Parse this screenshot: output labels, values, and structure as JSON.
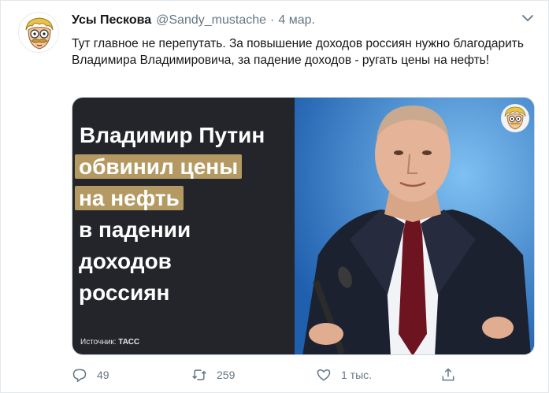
{
  "author": {
    "name": "Усы Пескова",
    "handle": "@Sandy_mustache",
    "separator": "·",
    "date": "4 мар."
  },
  "tweet": {
    "text": "Тут главное не перепутать. За повышение доходов россиян нужно благодарить Владимира Владимировича, за падение доходов - ругать цены на нефть!"
  },
  "media": {
    "headline": {
      "line1": "Владимир Путин",
      "line2": "обвинил цены",
      "line3": "на нефть",
      "line4": "в падении",
      "line5": "доходов",
      "line6": "россиян"
    },
    "source_label": "Источник:",
    "source_name": "ТАСС",
    "highlight_color": "#b49a62"
  },
  "actions": {
    "reply_count": "49",
    "retweet_count": "259",
    "like_count": "1 тыс."
  },
  "icons": [
    "chevron-down-icon",
    "reply-icon",
    "retweet-icon",
    "like-icon",
    "share-icon"
  ]
}
